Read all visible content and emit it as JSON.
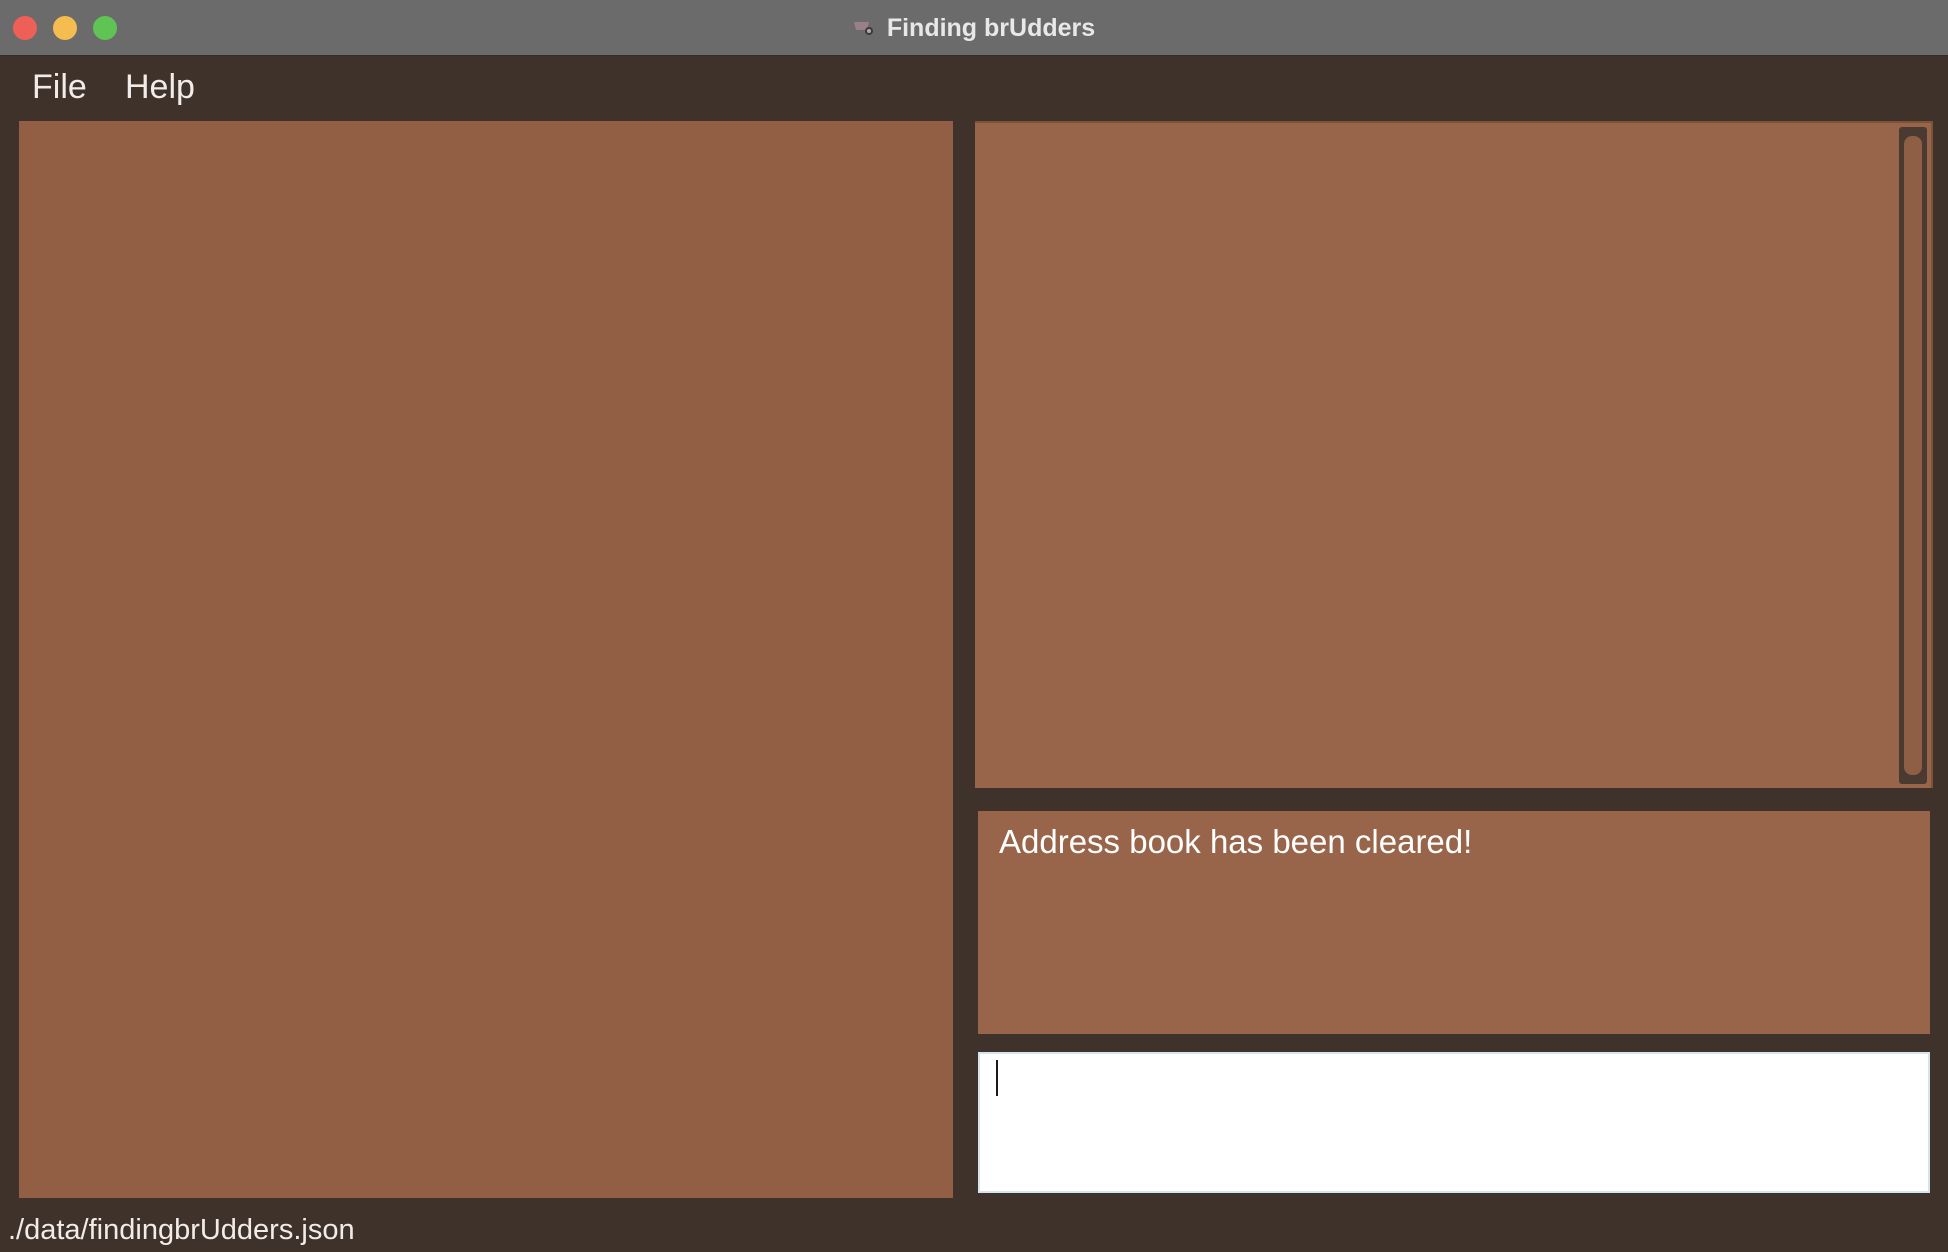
{
  "window": {
    "title": "Finding brUdders",
    "app_icon": "brudder-app-icon"
  },
  "menubar": {
    "items": [
      {
        "label": "File"
      },
      {
        "label": "Help"
      }
    ]
  },
  "result_display": {
    "message": "Address book has been cleared!"
  },
  "command_box": {
    "value": "",
    "placeholder": ""
  },
  "status_bar": {
    "save_location": "./data/findingbrUdders.json"
  },
  "colors": {
    "background": "#3f322b",
    "titlebar": "#6b6b6b",
    "panel_left": "#935f44",
    "panel_right": "#99654a",
    "text": "#ffffff"
  }
}
